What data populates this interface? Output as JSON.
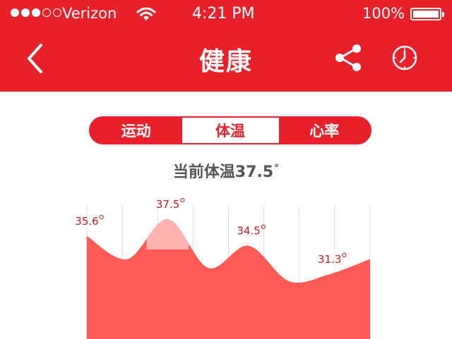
{
  "status_bar": {
    "signal_filled": 3,
    "signal_total": 5,
    "carrier": "Verizon",
    "time": "4:21 PM",
    "battery_text": "100%",
    "battery_level": 1.0
  },
  "nav": {
    "title": "健康",
    "back_icon": "chevron-left-icon",
    "share_icon": "share-icon",
    "history_icon": "clock-icon"
  },
  "tabs": [
    {
      "label": "运动",
      "active": false
    },
    {
      "label": "体温",
      "active": true
    },
    {
      "label": "心率",
      "active": false
    }
  ],
  "current_reading": {
    "label": "当前体温37.5",
    "degree": "°"
  },
  "colors": {
    "accent": "#e8202a",
    "area": "#ff5a55",
    "highlight": "#ffb3b0",
    "label": "#c8191f"
  },
  "chart_data": {
    "type": "area",
    "title": "",
    "xlabel": "",
    "ylabel": "",
    "x": [
      0,
      1,
      2,
      3,
      4,
      5,
      6,
      7
    ],
    "values": [
      35.6,
      33.0,
      37.5,
      32.0,
      34.5,
      30.5,
      31.3,
      33.0
    ],
    "labels": [
      {
        "index": 0,
        "text": "35.6"
      },
      {
        "index": 2,
        "text": "37.5"
      },
      {
        "index": 4,
        "text": "34.5"
      },
      {
        "index": 6,
        "text": "31.3"
      }
    ],
    "highlight_index": 2,
    "grid": true,
    "ylim": [
      24,
      39
    ]
  }
}
